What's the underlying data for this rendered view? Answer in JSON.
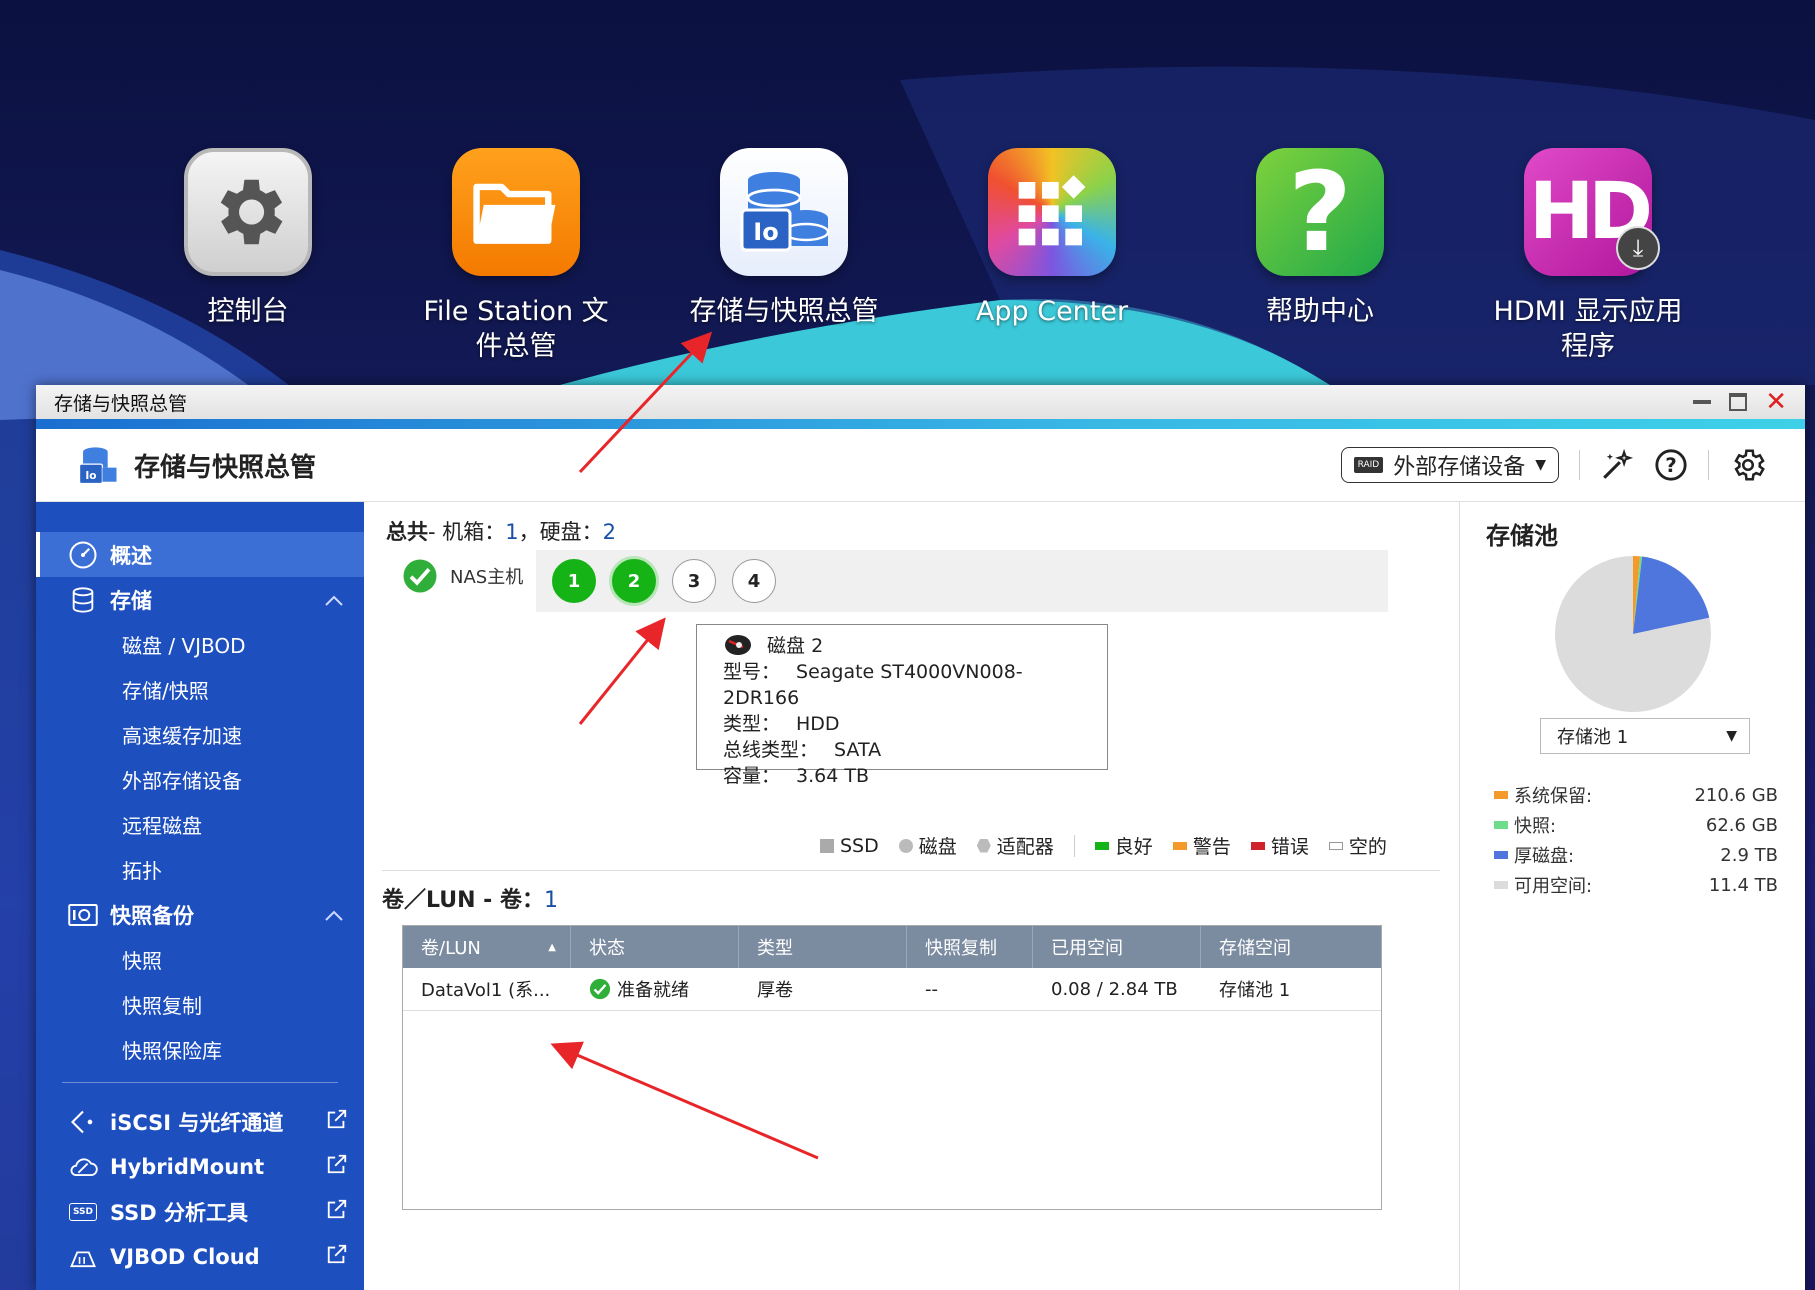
{
  "desktop": {
    "icons": [
      {
        "label": "控制台",
        "icon": "gear-icon"
      },
      {
        "label": "File Station 文件总管",
        "icon": "folder-icon"
      },
      {
        "label": "存储与快照总管",
        "icon": "storage-icon"
      },
      {
        "label": "App Center",
        "icon": "app-grid-icon"
      },
      {
        "label": "帮助中心",
        "icon": "help-icon"
      },
      {
        "label": "HDMI 显示应用程序",
        "icon": "hd-icon"
      }
    ],
    "hdmi_tile_text": "HD"
  },
  "window": {
    "title": "存储与快照总管",
    "app_title": "存储与快照总管",
    "ext_storage_label": "外部存储设备",
    "raid_badge": "RAID"
  },
  "sidebar": {
    "overview": "概述",
    "storage": "存储",
    "storage_items": [
      "磁盘 / VJBOD",
      "存储/快照",
      "高速缓存加速",
      "外部存储设备",
      "远程磁盘",
      "拓扑"
    ],
    "snapshot_backup": "快照备份",
    "snapshot_items": [
      "快照",
      "快照复制",
      "快照保险库"
    ],
    "iscsi": "iSCSI 与光纤通道",
    "hybridmount": "HybridMount",
    "ssd_tool": "SSD 分析工具",
    "vjbod_cloud": "VJBOD Cloud",
    "ssd_badge": "SSD"
  },
  "summary": {
    "total_label": "总共",
    "enclosure_label": "- 机箱：",
    "enclosure_count": "1",
    "disk_label": "，硬盘：",
    "disk_count": "2"
  },
  "nas": {
    "label": "NAS主机",
    "slots": [
      "1",
      "2",
      "3",
      "4"
    ]
  },
  "tooltip": {
    "title": "磁盘 2",
    "model_label": "型号：",
    "model": "Seagate ST4000VN008-2DR166",
    "type_label": "类型：",
    "type": "HDD",
    "bus_label": "总线类型：",
    "bus": "SATA",
    "capacity_label": "容量：",
    "capacity": "3.64 TB"
  },
  "legend": {
    "ssd": "SSD",
    "disk": "磁盘",
    "adapter": "适配器",
    "good": "良好",
    "warning": "警告",
    "error": "错误",
    "empty": "空的"
  },
  "volumes": {
    "title": "卷／LUN - 卷：",
    "count": "1",
    "headers": [
      "卷/LUN",
      "状态",
      "类型",
      "快照复制",
      "已用空间",
      "存储空间"
    ],
    "rows": [
      {
        "name": "DataVol1 (系...",
        "status": "准备就绪",
        "type": "厚卷",
        "snap": "--",
        "used": "0.08 / 2.84 TB",
        "pool": "存储池 1"
      }
    ]
  },
  "pool": {
    "title": "存储池",
    "selected": "存储池 1",
    "stats": [
      {
        "label": "系统保留:",
        "value": "210.6 GB",
        "color": "#f39a2a"
      },
      {
        "label": "快照:",
        "value": "62.6 GB",
        "color": "#6fdc8c"
      },
      {
        "label": "厚磁盘:",
        "value": "2.9 TB",
        "color": "#4f76dc"
      },
      {
        "label": "可用空间:",
        "value": "11.4 TB",
        "color": "#dcdcdc"
      }
    ],
    "chart_fractions": [
      0.0144,
      0.0043,
      0.198,
      0.7833
    ]
  },
  "colors": {
    "sidebar": "#1e4fbf",
    "good": "#16b316",
    "warning": "#f39a2a",
    "error": "#d0222a",
    "annotation_arrow": "#e8262a"
  }
}
